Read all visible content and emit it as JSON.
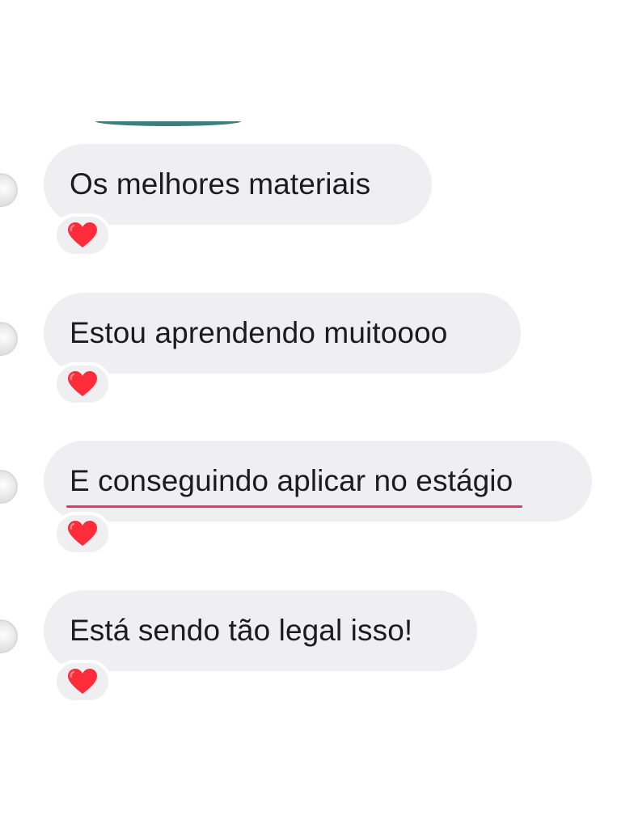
{
  "messages": [
    {
      "text": "Os melhores materiais",
      "reaction": "red-heart-icon"
    },
    {
      "text": "Estou aprendendo muitoooo",
      "reaction": "red-heart-icon"
    },
    {
      "text": "E conseguindo aplicar no estágio",
      "reaction": "red-heart-icon",
      "highlighted": true
    },
    {
      "text": "Está sendo tão legal isso!",
      "reaction": "red-heart-icon"
    }
  ],
  "colors": {
    "bubble": "#efeff1",
    "text": "#1c1c1e",
    "heart": "#ff2d3a",
    "underline": "#e8336b",
    "prev_bubble_edge": "#3e7c80"
  }
}
